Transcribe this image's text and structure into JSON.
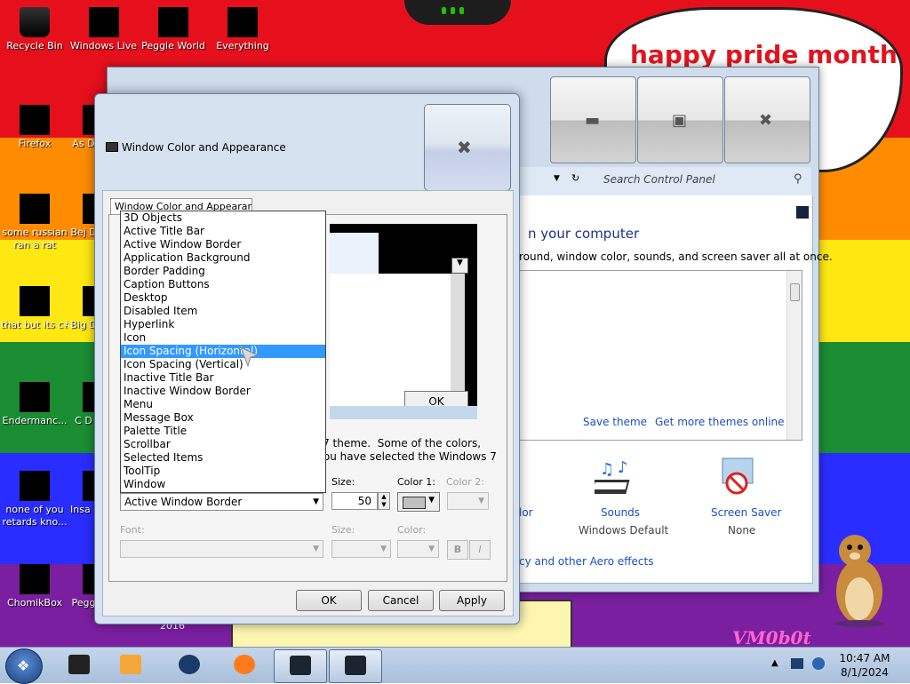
{
  "wallpaper": {
    "bubble_text": "happy pride month",
    "logo_text": "VM0b0t",
    "under_text": "2016"
  },
  "desktop_icons": [
    {
      "label": "Recycle Bin"
    },
    {
      "label": "Windows Live Ma"
    },
    {
      "label": "Peggle World"
    },
    {
      "label": "Everything"
    },
    {
      "label": "Firefox"
    },
    {
      "label": "As D"
    },
    {
      "label": "some russian ran a rat"
    },
    {
      "label": "Bej D"
    },
    {
      "label": "that but its c#"
    },
    {
      "label": "Big D"
    },
    {
      "label": "Endermanc..."
    },
    {
      "label": "C D"
    },
    {
      "label": "none of you retards kno..."
    },
    {
      "label": "Insa D"
    },
    {
      "label": "ChomikBox"
    },
    {
      "label": "Pegg"
    }
  ],
  "control_panel": {
    "search_placeholder": "Search Control Panel",
    "heading": "n your computer",
    "description": "round, window color, sounds, and screen saver all at once.",
    "save_theme": "Save theme",
    "get_more_themes": "Get more themes online",
    "color_link": "lor",
    "sounds_label": "Sounds",
    "sounds_value": "Windows Default",
    "screensaver_label": "Screen Saver",
    "screensaver_value": "None",
    "aero_link": "cy and other Aero effects"
  },
  "dialog": {
    "title": "Window Color and Appearance",
    "tab_label": "Window Color and Appearance",
    "preview_ok": "OK",
    "description": "s 7 theme.  Some of the colors,\n you have selected the Windows 7",
    "item_list": [
      "3D Objects",
      "Active Title Bar",
      "Active Window Border",
      "Application Background",
      "Border Padding",
      "Caption Buttons",
      "Desktop",
      "Disabled Item",
      "Hyperlink",
      "Icon",
      "Icon Spacing (Horizontal)",
      "Icon Spacing (Vertical)",
      "Inactive Title Bar",
      "Inactive Window Border",
      "Menu",
      "Message Box",
      "Palette Title",
      "Scrollbar",
      "Selected Items",
      "ToolTip",
      "Window"
    ],
    "highlighted_item": "Icon Spacing (Horizontal)",
    "item_selected": "Active Window Border",
    "size_label": "Size:",
    "size_value": "50",
    "color1_label": "Color 1:",
    "color2_label": "Color 2:",
    "font_label": "Font:",
    "font_size_label": "Size:",
    "font_color_label": "Color:",
    "bold_label": "B",
    "italic_label": "I",
    "ok": "OK",
    "cancel": "Cancel",
    "apply": "Apply"
  },
  "taskbar": {
    "time": "10:47 AM",
    "date": "8/1/2024"
  },
  "colors": {
    "selection": "#3399ff",
    "link": "#1b4fbf",
    "bubble_text": "#e0151f"
  }
}
